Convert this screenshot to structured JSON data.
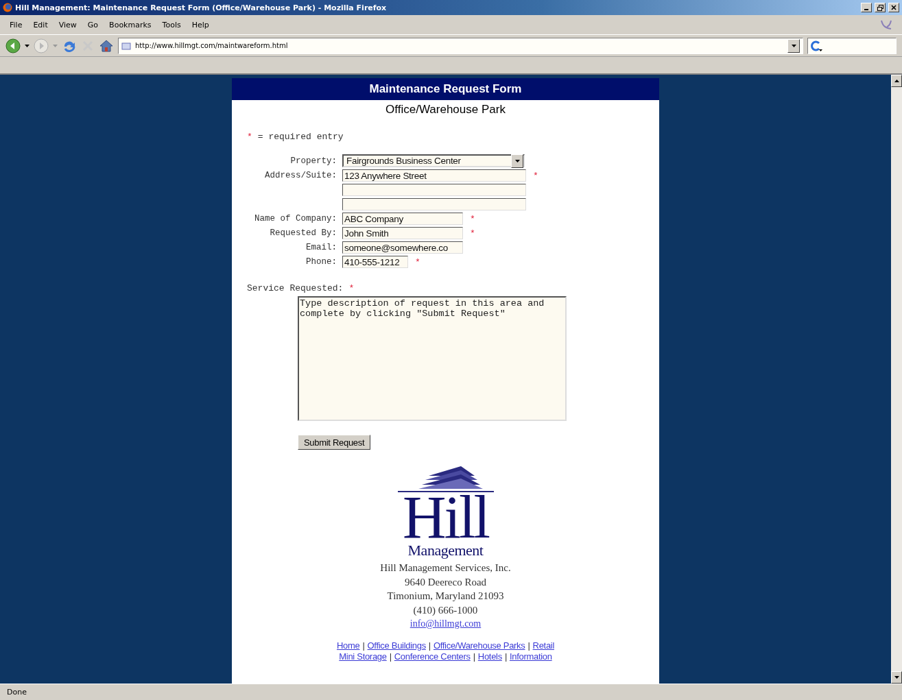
{
  "window": {
    "title": "Hill Management: Maintenance Request Form (Office/Warehouse Park) - Mozilla Firefox"
  },
  "menu": [
    "File",
    "Edit",
    "View",
    "Go",
    "Bookmarks",
    "Tools",
    "Help"
  ],
  "address_bar": {
    "value": "http://www.hillmgt.com/maintwareform.html"
  },
  "page": {
    "header": "Maintenance Request Form",
    "subtitle": "Office/Warehouse Park",
    "legend": {
      "mark": "*",
      "text": "= required entry"
    },
    "fields": [
      {
        "kind": "select",
        "label": "Property:",
        "value": "Fairgrounds Business Center"
      },
      {
        "kind": "wide",
        "label": "Address/Suite:",
        "value": "123 Anywhere Street",
        "required_mark": "*"
      },
      {
        "kind": "wide"
      },
      {
        "kind": "wide"
      },
      {
        "kind": "medium",
        "label": "Name of Company:",
        "value": "ABC Company",
        "required_mark": "*"
      },
      {
        "kind": "medium",
        "label": "Requested By:",
        "value": "John Smith",
        "required_mark": "*"
      },
      {
        "kind": "medium",
        "label": "Email:",
        "value": "someone@somewhere.co"
      },
      {
        "kind": "short",
        "label": "Phone:",
        "value": "410-555-1212",
        "required_mark": "*"
      }
    ],
    "service": {
      "label": "Service Requested:",
      "required_mark": "*",
      "value": "Type description of request in this area and complete by clicking \"Submit Request\""
    },
    "submit": "Submit Request",
    "logo": {
      "name": "Hill",
      "tagline": "Management"
    },
    "contact": [
      "Hill Management Services, Inc.",
      "9640 Deereco Road",
      "Timonium, Maryland 21093",
      "(410) 666-1000"
    ],
    "email_link": "info@hillmgt.com",
    "nav_rows": [
      [
        {
          "kind": "link",
          "text": "Home"
        },
        {
          "kind": "separator",
          "text": "|"
        },
        {
          "kind": "link",
          "text": "Office Buildings"
        },
        {
          "kind": "separator",
          "text": "|"
        },
        {
          "kind": "link",
          "text": "Office/Warehouse Parks"
        },
        {
          "kind": "separator",
          "text": "|"
        },
        {
          "kind": "link",
          "text": "Retail"
        }
      ],
      [
        {
          "kind": "link",
          "text": "Mini Storage"
        },
        {
          "kind": "separator",
          "text": "|"
        },
        {
          "kind": "link",
          "text": "Conference Centers"
        },
        {
          "kind": "separator",
          "text": "|"
        },
        {
          "kind": "link",
          "text": "Hotels"
        },
        {
          "kind": "separator",
          "text": "|"
        },
        {
          "kind": "link",
          "text": "Information"
        }
      ]
    ]
  },
  "status_bar": {
    "text": "Done"
  }
}
